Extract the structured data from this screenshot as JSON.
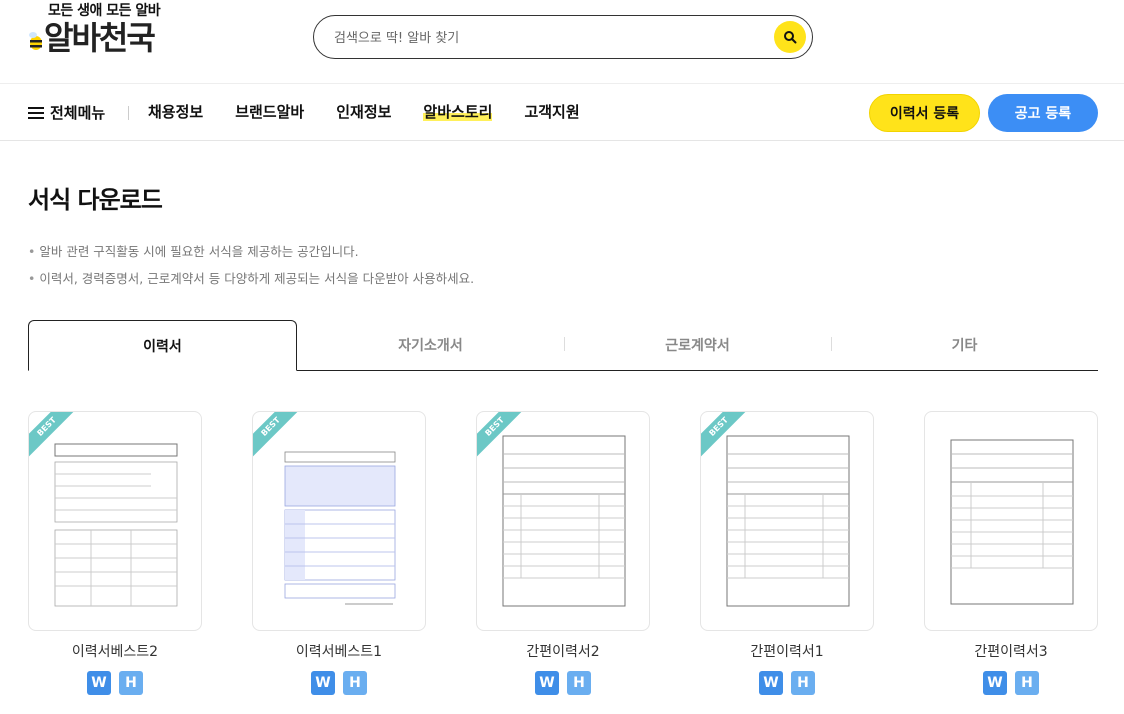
{
  "header": {
    "slogan": "모든 생애 모든 알바",
    "brand": "알바천국",
    "search_placeholder": "검색으로 딱! 알바 찾기"
  },
  "nav": {
    "all_menu": "전체메뉴",
    "items": [
      "채용정보",
      "브랜드알바",
      "인재정보",
      "알바스토리",
      "고객지원"
    ],
    "active_index": 3,
    "resume_button": "이력서 등록",
    "post_button": "공고 등록"
  },
  "page": {
    "title": "서식 다운로드",
    "desc": [
      "알바 관련 구직활동 시에 필요한 서식을 제공하는 공간입니다.",
      "이력서, 경력증명서, 근로계약서 등 다양하게 제공되는 서식을 다운받아 사용하세요."
    ]
  },
  "tabs": [
    "이력서",
    "자기소개서",
    "근로계약서",
    "기타"
  ],
  "active_tab": 0,
  "cards": [
    {
      "name": "이력서베스트2",
      "best": true,
      "badge": "BEST",
      "w": "W",
      "h": "H"
    },
    {
      "name": "이력서베스트1",
      "best": true,
      "badge": "BEST",
      "w": "W",
      "h": "H"
    },
    {
      "name": "간편이력서2",
      "best": true,
      "badge": "BEST",
      "w": "W",
      "h": "H"
    },
    {
      "name": "간편이력서1",
      "best": true,
      "badge": "BEST",
      "w": "W",
      "h": "H"
    },
    {
      "name": "간편이력서3",
      "best": false,
      "badge": "",
      "w": "W",
      "h": "H"
    }
  ],
  "colors": {
    "accent_yellow": "#ffe31a",
    "accent_blue": "#3c8ef5",
    "best_ribbon": "#6cc8c6"
  }
}
